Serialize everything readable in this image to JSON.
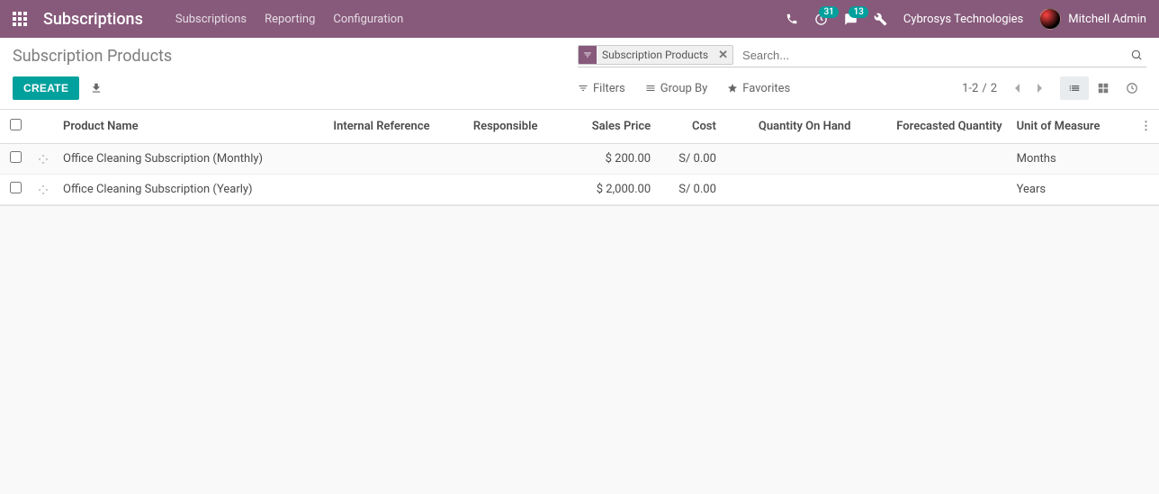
{
  "navbar": {
    "brand": "Subscriptions",
    "menu": [
      "Subscriptions",
      "Reporting",
      "Configuration"
    ],
    "activities_badge": "31",
    "messages_badge": "13",
    "company": "Cybrosys Technologies",
    "user": "Mitchell Admin"
  },
  "breadcrumb": "Subscription Products",
  "search": {
    "facet": "Subscription Products",
    "placeholder": "Search..."
  },
  "buttons": {
    "create": "CREATE",
    "filters": "Filters",
    "group_by": "Group By",
    "favorites": "Favorites"
  },
  "pager": {
    "range": "1-2",
    "sep": "/",
    "total": "2"
  },
  "table": {
    "columns": {
      "product_name": "Product Name",
      "internal_reference": "Internal Reference",
      "responsible": "Responsible",
      "sales_price": "Sales Price",
      "cost": "Cost",
      "qty_on_hand": "Quantity On Hand",
      "forecasted_qty": "Forecasted Quantity",
      "uom": "Unit of Measure"
    },
    "rows": [
      {
        "product_name": "Office Cleaning Subscription (Monthly)",
        "internal_reference": "",
        "responsible": "",
        "sales_price": "$ 200.00",
        "cost": "S/ 0.00",
        "qty_on_hand": "",
        "forecasted_qty": "",
        "uom": "Months"
      },
      {
        "product_name": "Office Cleaning Subscription (Yearly)",
        "internal_reference": "",
        "responsible": "",
        "sales_price": "$ 2,000.00",
        "cost": "S/ 0.00",
        "qty_on_hand": "",
        "forecasted_qty": "",
        "uom": "Years"
      }
    ]
  }
}
